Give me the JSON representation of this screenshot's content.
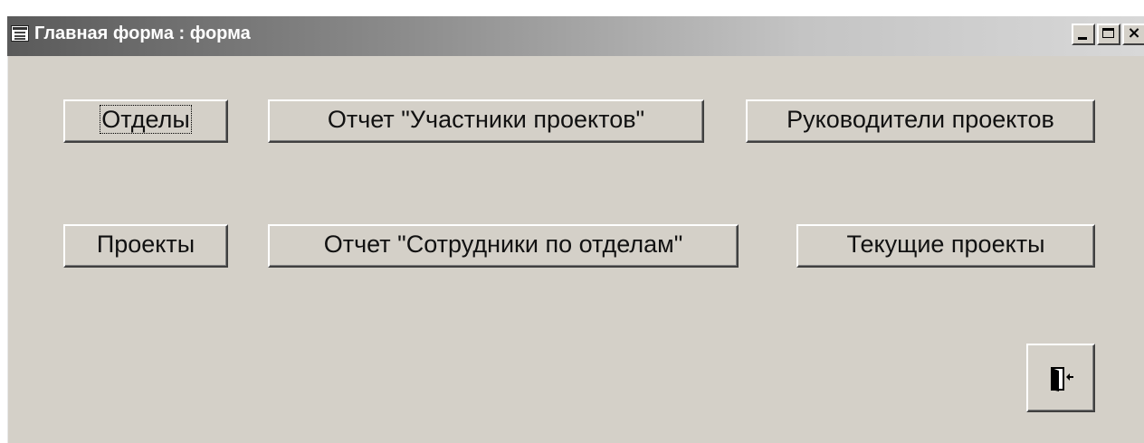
{
  "window": {
    "title": "Главная форма : форма"
  },
  "buttons": {
    "otdely": "Отделы",
    "uchastniki": "Отчет \"Участники проектов\"",
    "rukovoditeli": "Руководители проектов",
    "proekty": "Проекты",
    "sotrudniki": "Отчет \"Сотрудники по отделам\"",
    "tekuschie": "Текущие проекты"
  },
  "icons": {
    "window_icon": "form-icon",
    "exit_icon": "exit-door-icon"
  }
}
